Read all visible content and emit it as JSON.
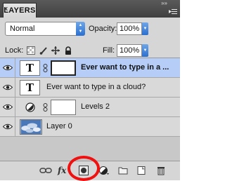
{
  "panel": {
    "tab_label": "LAYERS",
    "tab_close": "x",
    "collapse": "»»"
  },
  "options": {
    "blend_mode": "Normal",
    "opacity_label": "Opacity:",
    "opacity_value": "100%",
    "lock_label": "Lock:",
    "fill_label": "Fill:",
    "fill_value": "100%"
  },
  "layers": [
    {
      "name": "Ever want to  type in a ...",
      "type": "text",
      "thumb_glyph": "T",
      "has_mask": true,
      "selected": true
    },
    {
      "name": "Ever want to  type in a cloud?",
      "type": "text",
      "thumb_glyph": "T",
      "has_mask": false,
      "selected": false
    },
    {
      "name": "Levels 2",
      "type": "adjustment",
      "has_mask": true,
      "selected": false
    },
    {
      "name": "Layer 0",
      "type": "image",
      "has_mask": false,
      "selected": false
    }
  ],
  "bottom_icons": [
    "link-layers-icon",
    "fx-icon",
    "add-mask-icon",
    "adjustment-layer-icon",
    "new-group-icon",
    "new-layer-icon",
    "trash-icon"
  ],
  "fx_glyph": "fx",
  "colors": {
    "selection": "#b5cdf7",
    "annotation": "#f01010",
    "accent": "#2a6fd0"
  }
}
